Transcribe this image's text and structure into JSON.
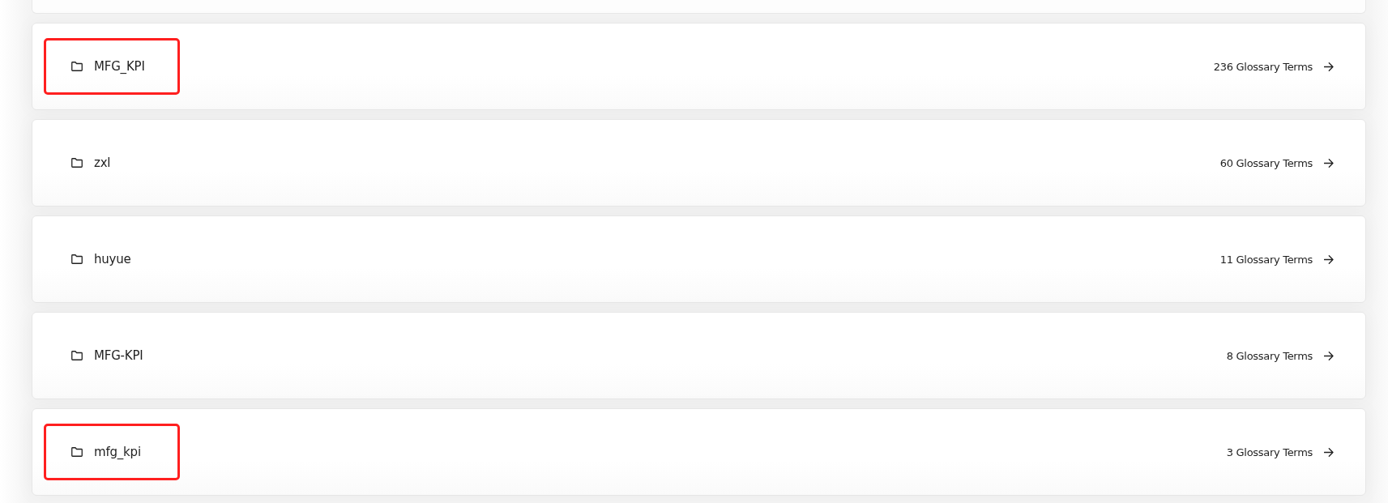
{
  "glossaries": [
    {
      "name": "MFG_KPI",
      "terms": "236 Glossary Terms",
      "highlighted": true
    },
    {
      "name": "zxl",
      "terms": "60 Glossary Terms",
      "highlighted": false
    },
    {
      "name": "huyue",
      "terms": "11 Glossary Terms",
      "highlighted": false
    },
    {
      "name": "MFG-KPI",
      "terms": "8 Glossary Terms",
      "highlighted": false
    },
    {
      "name": "mfg_kpi",
      "terms": "3 Glossary Terms",
      "highlighted": true
    }
  ]
}
